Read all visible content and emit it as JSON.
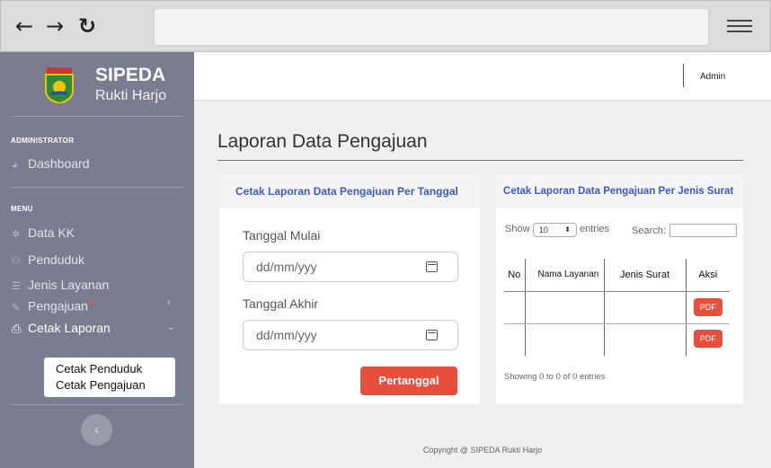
{
  "browser": {
    "back": "←",
    "forward": "→",
    "reload": "↻"
  },
  "brand": {
    "title": "SIPEDA",
    "subtitle": "Rukti Harjo"
  },
  "sidebar": {
    "admin_section": "ADMINISTRATOR",
    "dashboard": "Dashboard",
    "menu_section": "MENU",
    "items": [
      {
        "label": "Data KK"
      },
      {
        "label": "Penduduk"
      },
      {
        "label": "Jenis Layanan"
      },
      {
        "label": "Pengajuan",
        "badge": "0"
      },
      {
        "label": "Cetak Laporan"
      }
    ],
    "submenu": [
      "Cetak Penduduk",
      "Cetak Pengajuan"
    ]
  },
  "topbar": {
    "user": "Admin"
  },
  "page": {
    "title": "Laporan Data Pengajuan"
  },
  "left_card": {
    "title": "Cetak Laporan Data Pengajuan Per Tanggal",
    "start_label": "Tanggal Mulai",
    "start_placeholder": "dd/mm/yyy",
    "end_label": "Tanggal Akhir",
    "end_placeholder": "dd/mm/yyy",
    "button": "Pertanggal"
  },
  "right_card": {
    "title": "Cetak Laporan Data Pengajuan Per Jenis Surat",
    "show": "Show",
    "entries_value": "10",
    "entries": "entries",
    "search": "Search:",
    "columns": [
      "No",
      "Nama Layanan",
      "Jenis Surat",
      "Aksi"
    ],
    "pdf_label": "PDF",
    "info": "Showing 0 to 0 of 0 entries"
  },
  "footer": "Copyright @ SIPEDA Rukti Harjo"
}
